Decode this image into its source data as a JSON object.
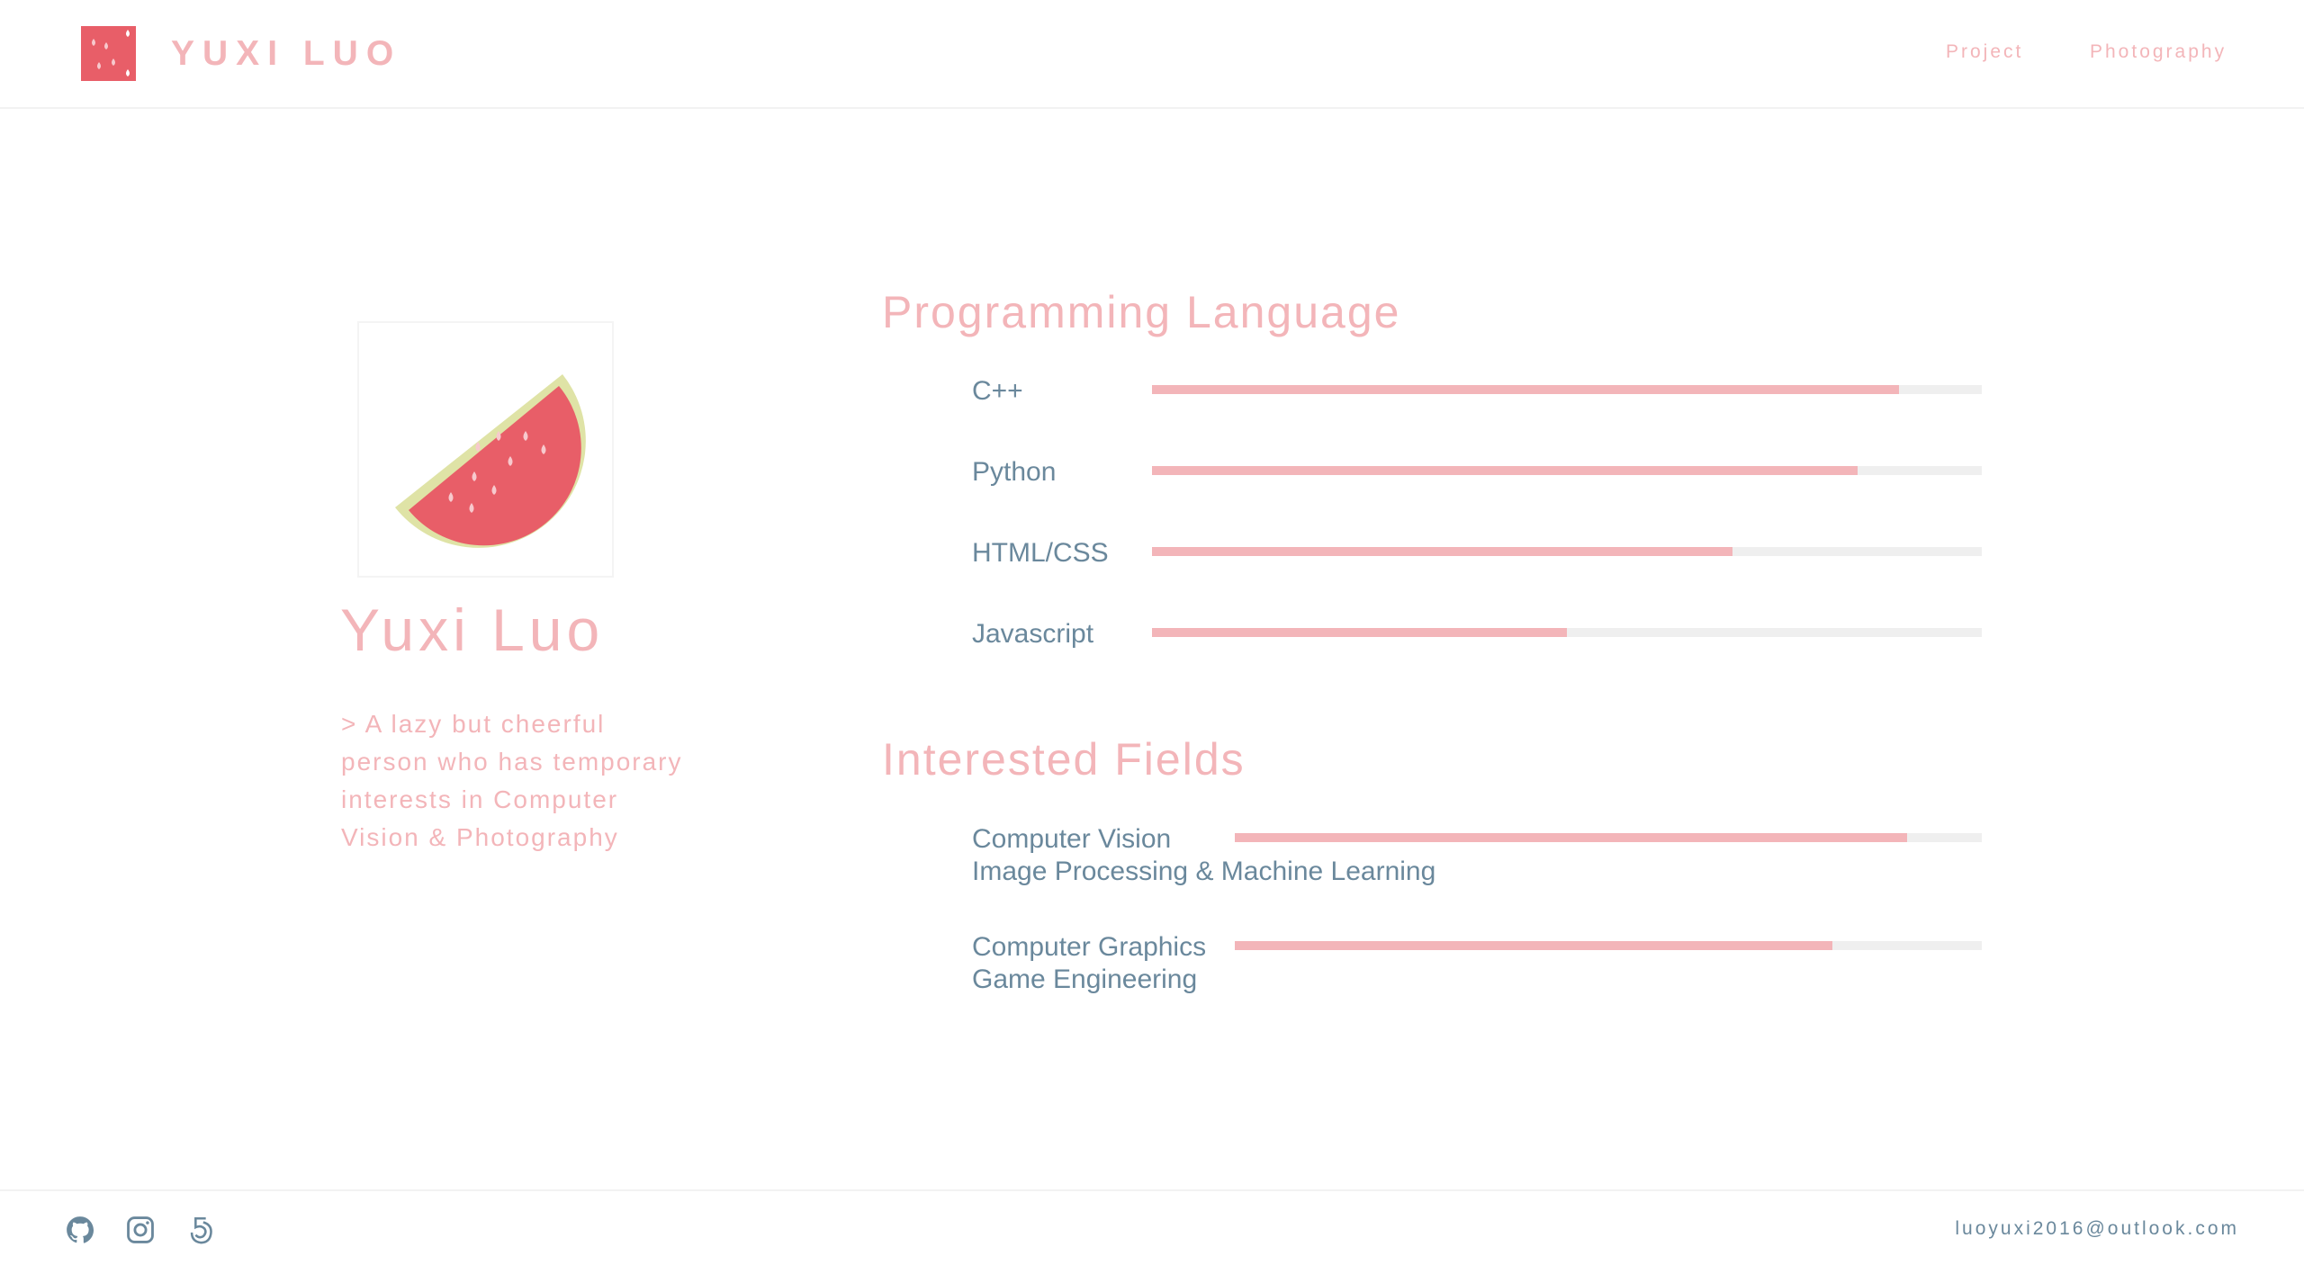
{
  "header": {
    "brand": "YUXI LUO",
    "nav": [
      {
        "label": "Project"
      },
      {
        "label": "Photography"
      }
    ]
  },
  "profile": {
    "name": "Yuxi Luo",
    "bio": "> A lazy but cheerful person who has temporary interests in Computer Vision & Photography"
  },
  "sections": {
    "languages": {
      "title": "Programming Language",
      "items": [
        {
          "label": "C++",
          "level": 0.9
        },
        {
          "label": "Python",
          "level": 0.85
        },
        {
          "label": "HTML/CSS",
          "level": 0.7
        },
        {
          "label": "Javascript",
          "level": 0.5
        }
      ]
    },
    "fields": {
      "title": "Interested Fields",
      "items": [
        {
          "line1": "Computer Vision",
          "line2": "Image Processing & Machine Learning",
          "level": 0.9
        },
        {
          "line1": "Computer Graphics",
          "line2": "Game Engineering",
          "level": 0.8
        }
      ]
    }
  },
  "footer": {
    "social": [
      {
        "icon": "github-icon"
      },
      {
        "icon": "instagram-icon"
      },
      {
        "icon": "500px-icon"
      }
    ],
    "email": "luoyuxi2016@outlook.com"
  },
  "colors": {
    "accent": "#f3b5b9",
    "text": "#6a889c",
    "watermelon": "#e85e68",
    "rind": "#dfe3a6",
    "track": "#efefef"
  }
}
